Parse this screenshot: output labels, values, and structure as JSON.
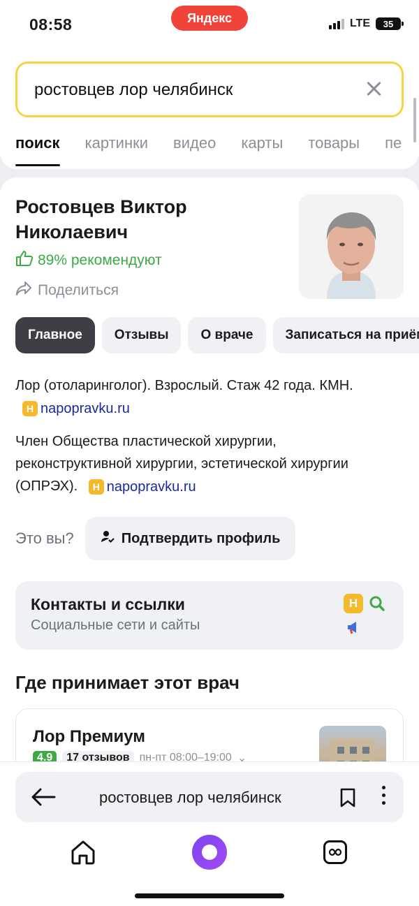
{
  "status_bar": {
    "time": "08:58",
    "brand": "Яндекс",
    "network": "LTE",
    "battery": "35"
  },
  "search": {
    "query": "ростовцев лор челябинск"
  },
  "tabs": [
    "поиск",
    "картинки",
    "видео",
    "карты",
    "товары",
    "пе"
  ],
  "doctor": {
    "name": "Ростовцев Виктор Николаевич",
    "recommend": "89% рекомендуют",
    "share": "Поделиться"
  },
  "chips": [
    "Главное",
    "Отзывы",
    "О враче",
    "Записаться на приём"
  ],
  "description": [
    {
      "text": "Лор (отоларинголог). Взрослый. Стаж 42 года. КМН.",
      "source": "napopravku.ru"
    },
    {
      "text": "Член Общества пластической хирургии, реконструктивной хирургии, эстетической хирургии (ОПРЭХ).",
      "source": "napopravku.ru"
    }
  ],
  "source_badge": "Н",
  "is_it_you": "Это вы?",
  "confirm_profile": "Подтвердить профиль",
  "contacts": {
    "title": "Контакты и ссылки",
    "subtitle": "Социальные сети и сайты",
    "icons": [
      "napopravku-icon",
      "search-icon",
      "megaphone-icon"
    ]
  },
  "where_title": "Где принимает этот врач",
  "clinic": {
    "name": "Лор Премиум",
    "rating": "4.9",
    "reviews": "17 отзывов",
    "hours": "пн-пт 08:00–19:00"
  },
  "bottom_bar": {
    "url_text": "ростовцев лор челябинск"
  },
  "colors": {
    "accent_yellow": "#f7d33f",
    "brand_red": "#f0433a",
    "recommend_green": "#3daa45",
    "link_blue": "#1a2a9c",
    "alice_purple": "#7a44f0"
  }
}
